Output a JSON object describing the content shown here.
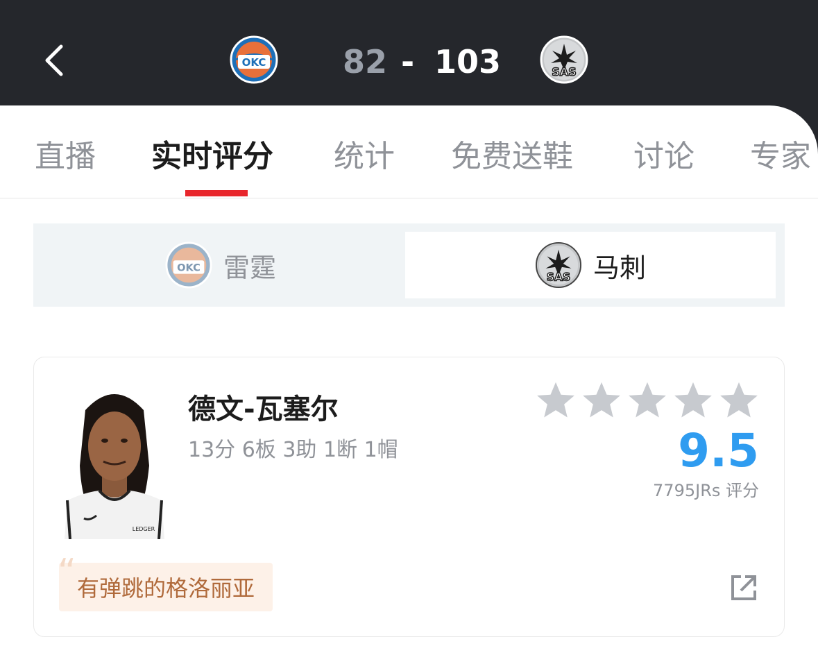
{
  "header": {
    "home_abbr": "OKC",
    "away_abbr": "SAS",
    "home_score": "82",
    "dash": "-",
    "away_score": "103"
  },
  "tabs": [
    {
      "label": "直播"
    },
    {
      "label": "实时评分"
    },
    {
      "label": "统计"
    },
    {
      "label": "免费送鞋"
    },
    {
      "label": "讨论"
    },
    {
      "label": "专家"
    }
  ],
  "team_switch": {
    "home_label": "雷霆",
    "away_label": "马刺",
    "selected": "away"
  },
  "player": {
    "name": "德文-瓦塞尔",
    "stats": "13分 6板 3助 1断 1帽",
    "stars_filled": 0,
    "stars_total": 5,
    "rating": "9.5",
    "rating_count": "7795JRs 评分",
    "comment": "有弹跳的格洛丽亚",
    "jersey_text": "LEDGER"
  },
  "colors": {
    "header_bg": "#25272c",
    "accent_red": "#e8262c",
    "rating_blue": "#2f9cf0",
    "comment_bg": "#fdf1e8",
    "comment_text": "#b06a3b"
  }
}
